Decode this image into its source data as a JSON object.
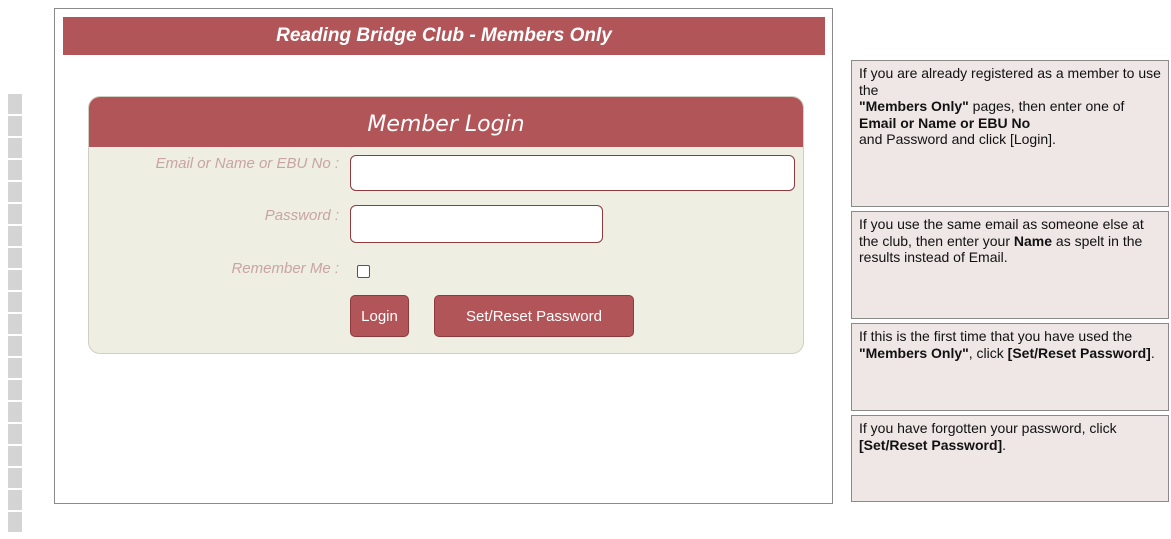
{
  "header": {
    "title": "Reading Bridge Club - Members Only"
  },
  "login": {
    "heading": "Member Login",
    "identifier_label": "Email or Name or EBU No :",
    "identifier_value": "",
    "password_label": "Password :",
    "password_value": "",
    "remember_label": "Remember Me :",
    "remember_checked": false,
    "login_button": "Login",
    "reset_button": "Set/Reset Password"
  },
  "help": {
    "box1": {
      "line1": "If you are already registered as a member to use the",
      "line2": "\"Members Only\"",
      "line3": " pages, then enter one of",
      "line4": "Email or Name or EBU No",
      "line5": "and Password and click [Login]."
    },
    "box2": {
      "part1": "If you use the same email as someone else at the club, then enter your ",
      "bold": "Name",
      "part2": " as spelt in the results instead of Email."
    },
    "box3": {
      "part1": "If this is the first time that you have used the ",
      "bold1": "\"Members Only\"",
      "part2": ", click ",
      "bold2": "[Set/Reset Password]",
      "part3": "."
    },
    "box4": {
      "part1": "If you have forgotten your password, click",
      "bold": "[Set/Reset Password]",
      "part2": "."
    }
  },
  "colors": {
    "accent": "#b25558",
    "login_bg": "#eeeee2",
    "help_bg": "#efe6e6",
    "label_text": "#c9a4a4"
  }
}
